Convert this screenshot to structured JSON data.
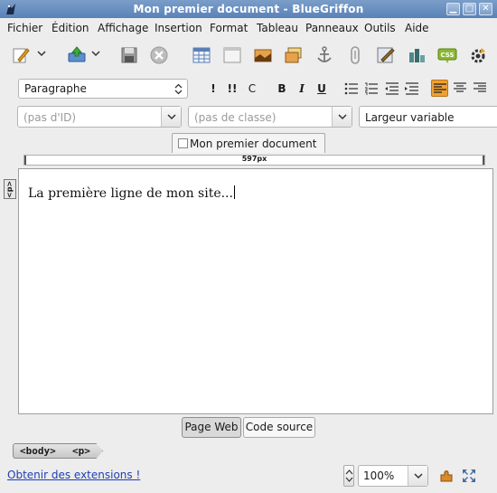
{
  "window": {
    "title": "Mon premier document - BlueGriffon"
  },
  "menu": [
    "Fichier",
    "Édition",
    "Affichage",
    "Insertion",
    "Format",
    "Tableau",
    "Panneaux",
    "Outils",
    "Aide"
  ],
  "toolbar_main": {
    "icons": [
      "new-document-icon",
      "publish-icon",
      "save-icon",
      "close-document-icon",
      "table-icon",
      "form-icon",
      "image-icon",
      "media-icon",
      "anchor-icon",
      "link-icon",
      "edit-image-icon",
      "chart-icon",
      "css-icon",
      "settings-icon"
    ]
  },
  "format_toolbar": {
    "paragraph_style": "Paragraphe",
    "buttons": [
      "!",
      "!!",
      "C",
      "B",
      "I",
      "U"
    ]
  },
  "selectors": {
    "id_placeholder": "(pas d'ID)",
    "class_placeholder": "(pas de classe)",
    "width_mode": "Largeur variable"
  },
  "document_tab": {
    "title": "Mon premier document"
  },
  "ruler": {
    "width_label": "597px"
  },
  "editor": {
    "content": "La première ligne de mon site...",
    "tag_marker": "<p>"
  },
  "view_tabs": {
    "wysiwyg": "Page Web",
    "source": "Code source"
  },
  "breadcrumbs": [
    "<body>",
    "<p>"
  ],
  "status": {
    "extensions_link": "Obtenir des extensions !",
    "zoom": "100%"
  }
}
